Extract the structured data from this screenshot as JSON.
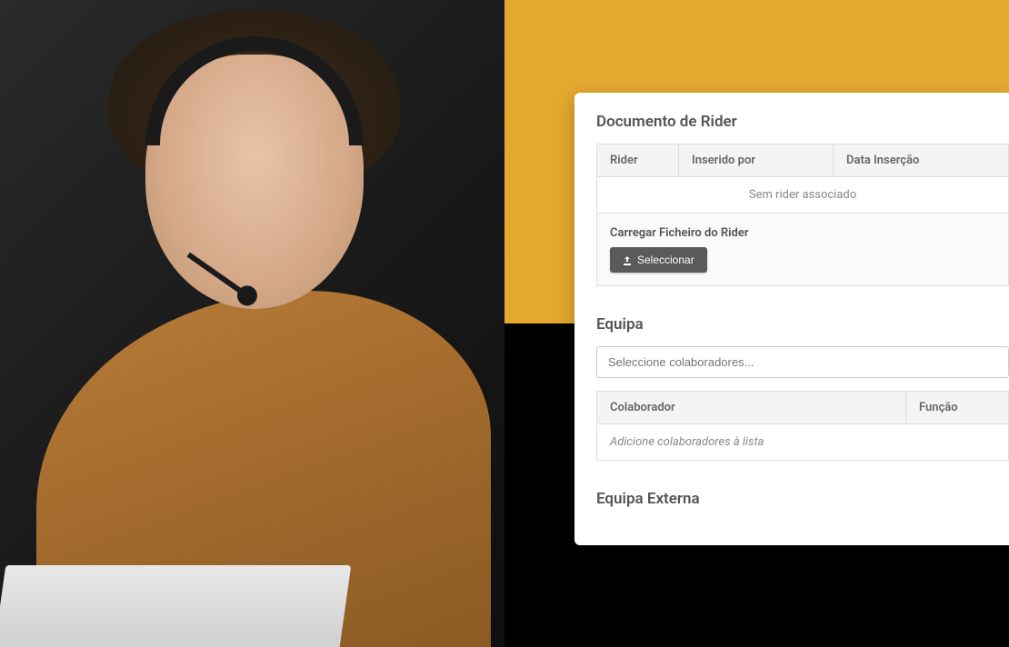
{
  "rider_section": {
    "title": "Documento de Rider",
    "columns": {
      "rider": "Rider",
      "inserido_por": "Inserido por",
      "data_insercao": "Data Inserção"
    },
    "empty_message": "Sem rider associado",
    "upload_label": "Carregar Ficheiro do Rider",
    "select_button": "Seleccionar"
  },
  "equipa_section": {
    "title": "Equipa",
    "select_placeholder": "Seleccione colaboradores...",
    "columns": {
      "colaborador": "Colaborador",
      "funcao": "Função"
    },
    "empty_message": "Adicione colaboradores à lista"
  },
  "equipa_externa_section": {
    "title": "Equipa Externa"
  }
}
